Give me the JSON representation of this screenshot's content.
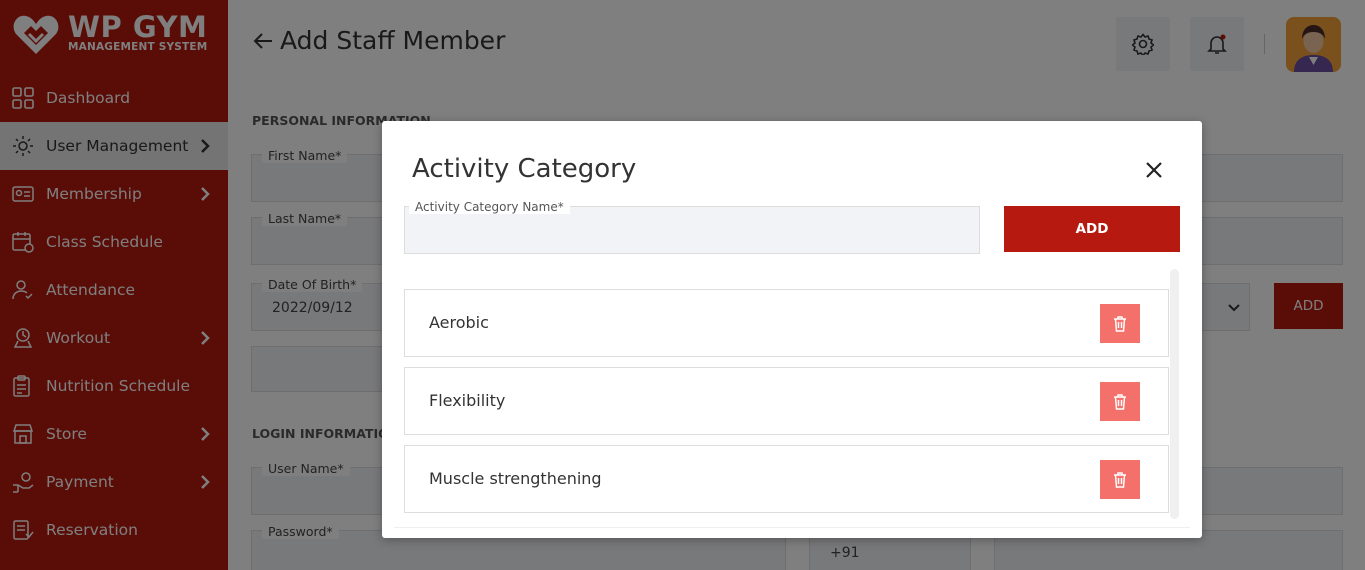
{
  "brand": {
    "name": "WP GYM",
    "subtitle": "MANAGEMENT SYSTEM"
  },
  "sidebar": {
    "items": [
      {
        "label": "Dashboard",
        "icon": "dashboard-grid-icon",
        "has_arrow": false,
        "active": false
      },
      {
        "label": "User Management",
        "icon": "users-gear-icon",
        "has_arrow": true,
        "active": true
      },
      {
        "label": "Membership",
        "icon": "id-card-icon",
        "has_arrow": true,
        "active": false
      },
      {
        "label": "Class Schedule",
        "icon": "calendar-icon",
        "has_arrow": false,
        "active": false
      },
      {
        "label": "Attendance",
        "icon": "user-check-icon",
        "has_arrow": false,
        "active": false
      },
      {
        "label": "Workout",
        "icon": "workout-icon",
        "has_arrow": true,
        "active": false
      },
      {
        "label": "Nutrition Schedule",
        "icon": "clipboard-icon",
        "has_arrow": false,
        "active": false
      },
      {
        "label": "Store",
        "icon": "store-icon",
        "has_arrow": true,
        "active": false
      },
      {
        "label": "Payment",
        "icon": "payment-hand-icon",
        "has_arrow": true,
        "active": false
      },
      {
        "label": "Reservation",
        "icon": "reservation-icon",
        "has_arrow": false,
        "active": false
      }
    ]
  },
  "header": {
    "title": "Add Staff Member",
    "settings_icon": "gear-icon",
    "notification_icon": "bell-icon"
  },
  "form": {
    "personal_section": "PERSONAL INFORMATION",
    "first_name_label": "First Name*",
    "last_name_label": "Last Name*",
    "dob_label": "Date Of Birth*",
    "dob_value": "2022/09/12",
    "add_label": "ADD",
    "login_section": "LOGIN INFORMATION",
    "username_label": "User Name*",
    "password_label": "Password*",
    "phone_code": "+91"
  },
  "modal": {
    "title": "Activity Category",
    "input_label": "Activity Category Name*",
    "input_value": "",
    "add_label": "ADD",
    "items": [
      {
        "label": "Aerobic"
      },
      {
        "label": "Flexibility"
      },
      {
        "label": "Muscle strengthening"
      }
    ]
  },
  "colors": {
    "brand_red": "#b5190f",
    "delete_pink": "#f4706a",
    "active_nav_bg": "#e9e9e9"
  }
}
